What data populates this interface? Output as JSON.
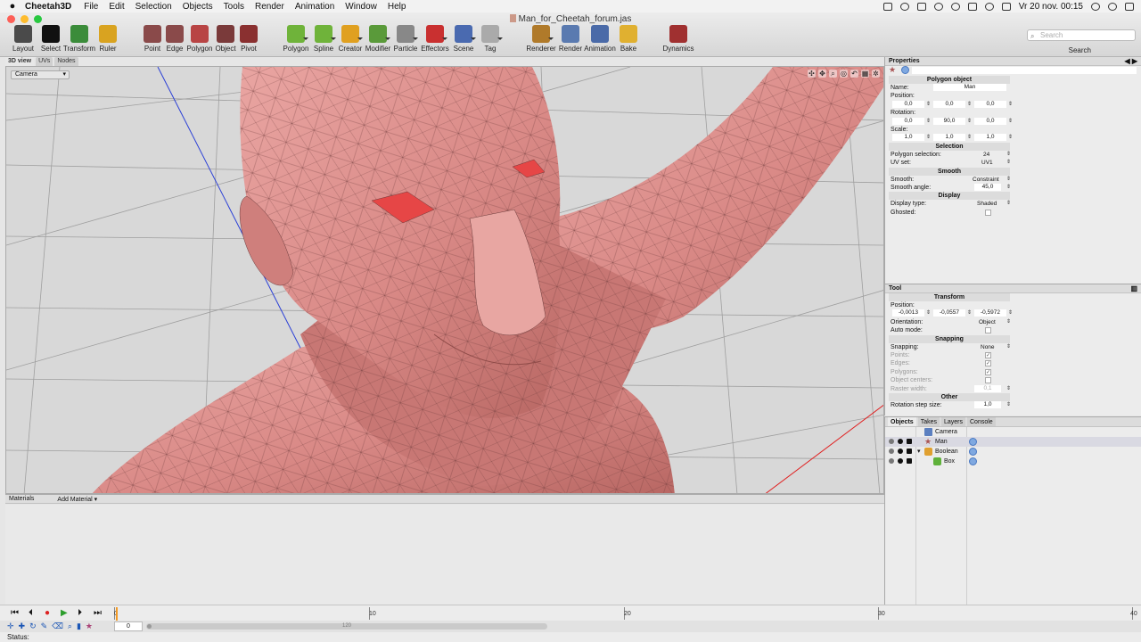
{
  "menubar": {
    "app": "Cheetah3D",
    "items": [
      "File",
      "Edit",
      "Selection",
      "Objects",
      "Tools",
      "Render",
      "Animation",
      "Window",
      "Help"
    ],
    "clock": "Vr 20 nov.  00:15"
  },
  "window": {
    "title": "Man_for_Cheetah_forum.jas"
  },
  "toolbar": {
    "tools": [
      {
        "label": "Layout",
        "icon": "layout-icon",
        "color": "#4a4a4a"
      },
      {
        "label": "Select",
        "icon": "cursor-icon",
        "color": "#111111"
      },
      {
        "label": "Transform",
        "icon": "transform-icon",
        "color": "#3b8c3a"
      },
      {
        "label": "Ruler",
        "icon": "ruler-icon",
        "color": "#d9a320"
      },
      {
        "label": "Point",
        "icon": "point-icon",
        "color": "#8a4a4a"
      },
      {
        "label": "Edge",
        "icon": "edge-icon",
        "color": "#8a4a4a"
      },
      {
        "label": "Polygon",
        "icon": "polygon-mode-icon",
        "color": "#b84444"
      },
      {
        "label": "Object",
        "icon": "object-mode-icon",
        "color": "#7a3a3a"
      },
      {
        "label": "Pivot",
        "icon": "pivot-icon",
        "color": "#8a3030"
      },
      {
        "label": "Polygon",
        "icon": "polygon-create-icon",
        "color": "#6fb33a"
      },
      {
        "label": "Spline",
        "icon": "spline-icon",
        "color": "#6fb33a"
      },
      {
        "label": "Creator",
        "icon": "creator-icon",
        "color": "#e0a020"
      },
      {
        "label": "Modifier",
        "icon": "modifier-icon",
        "color": "#5a9a3a"
      },
      {
        "label": "Particle",
        "icon": "particle-icon",
        "color": "#888888"
      },
      {
        "label": "Effectors",
        "icon": "effectors-icon",
        "color": "#c93030"
      },
      {
        "label": "Scene",
        "icon": "scene-icon",
        "color": "#4a6ab0"
      },
      {
        "label": "Tag",
        "icon": "tag-icon",
        "color": "#aaaaaa"
      },
      {
        "label": "Renderer",
        "icon": "renderer-icon",
        "color": "#b07a2a"
      },
      {
        "label": "Render",
        "icon": "render-icon",
        "color": "#5a7ab0"
      },
      {
        "label": "Animation",
        "icon": "animation-icon",
        "color": "#4a6aa8"
      },
      {
        "label": "Bake",
        "icon": "bake-icon",
        "color": "#e0b030"
      },
      {
        "label": "Dynamics",
        "icon": "dynamics-icon",
        "color": "#a03030"
      }
    ],
    "search_placeholder": "Search",
    "search_label": "Search"
  },
  "viewport": {
    "tabs": [
      "3D view",
      "UVs",
      "Nodes"
    ],
    "camera": "Camera"
  },
  "materials": {
    "title": "Materials",
    "add": "Add Material"
  },
  "timeline": {
    "ticks": [
      "0",
      "10",
      "20",
      "30",
      "40"
    ],
    "frame": "0",
    "range_end": "120"
  },
  "status": {
    "label": "Status:"
  },
  "properties": {
    "title": "Properties",
    "section": "Polygon object",
    "name_label": "Name:",
    "name_value": "Man",
    "position_label": "Position:",
    "position": [
      "0,0",
      "0,0",
      "0,0"
    ],
    "rotation_label": "Rotation:",
    "rotation": [
      "0,0",
      "90,0",
      "0,0"
    ],
    "scale_label": "Scale:",
    "scale": [
      "1,0",
      "1,0",
      "1,0"
    ],
    "selection_section": "Selection",
    "poly_sel_label": "Polygon selection:",
    "poly_sel_value": "24",
    "uvset_label": "UV set:",
    "uvset_value": "UV1",
    "smooth_section": "Smooth",
    "smooth_label": "Smooth:",
    "smooth_value": "Constraint",
    "smooth_angle_label": "Smooth angle:",
    "smooth_angle_value": "45,0",
    "display_section": "Display",
    "display_type_label": "Display type:",
    "display_type_value": "Shaded",
    "ghosted_label": "Ghosted:"
  },
  "tool": {
    "title": "Tool",
    "section": "Transform",
    "position_label": "Position:",
    "position": [
      "-0,0013",
      "-0,0557",
      "-0,5972"
    ],
    "orientation_label": "Orientation:",
    "orientation_value": "Object",
    "auto_mode_label": "Auto mode:",
    "snapping_section": "Snapping",
    "snapping_label": "Snapping:",
    "snapping_value": "None",
    "points_label": "Points:",
    "edges_label": "Edges:",
    "polygons_label": "Polygons:",
    "object_centers_label": "Object centers:",
    "raster_label": "Raster width:",
    "raster_value": "0,1",
    "other_section": "Other",
    "rot_step_label": "Rotation step size:",
    "rot_step_value": "1,0"
  },
  "objects_panel": {
    "tabs": [
      "Objects",
      "Takes",
      "Layers",
      "Console"
    ],
    "items": [
      {
        "name": "Camera",
        "icon": "camera-icon"
      },
      {
        "name": "Man",
        "icon": "polygon-object-icon"
      },
      {
        "name": "Boolean",
        "icon": "boolean-icon"
      },
      {
        "name": "Box",
        "icon": "box-icon"
      }
    ]
  }
}
